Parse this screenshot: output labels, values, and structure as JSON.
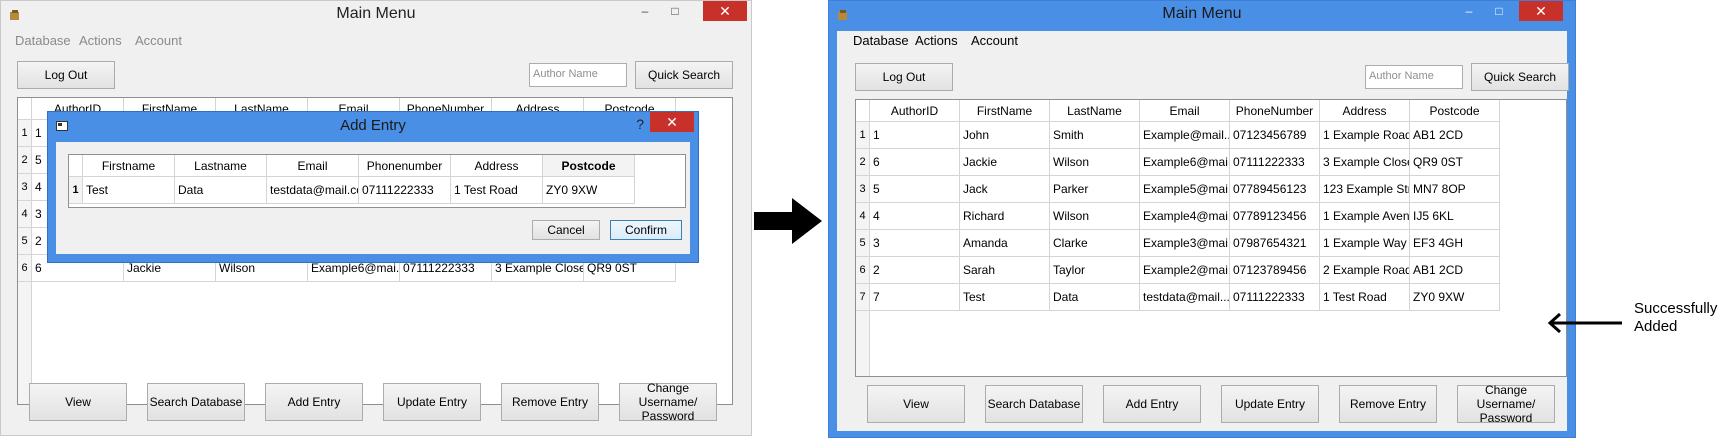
{
  "left_window": {
    "title": "Main Menu",
    "menu": [
      "Database",
      "Actions",
      "Account"
    ],
    "logout_label": "Log Out",
    "search_placeholder": "Author Name",
    "quick_search_label": "Quick Search",
    "columns": [
      "AuthorID",
      "FirstName",
      "LastName",
      "Email",
      "PhoneNumber",
      "Address",
      "Postcode"
    ],
    "rows": [
      {
        "num": "1",
        "cells": [
          "1",
          "",
          "",
          "",
          "",
          "",
          ""
        ]
      },
      {
        "num": "2",
        "cells": [
          "5",
          "",
          "",
          "",
          "",
          "",
          ""
        ]
      },
      {
        "num": "3",
        "cells": [
          "4",
          "",
          "",
          "",
          "",
          "",
          ""
        ]
      },
      {
        "num": "4",
        "cells": [
          "3",
          "",
          "",
          "",
          "",
          "",
          ""
        ]
      },
      {
        "num": "5",
        "cells": [
          "2",
          "",
          "",
          "",
          "",
          "",
          ""
        ]
      },
      {
        "num": "6",
        "cells": [
          "6",
          "Jackie",
          "Wilson",
          "Example6@mai...",
          "07111222333",
          "3 Example Close",
          "QR9 0ST"
        ]
      }
    ],
    "buttons": [
      "View",
      "Search Database",
      "Add Entry",
      "Update Entry",
      "Remove Entry",
      "Change Username/ Password"
    ]
  },
  "dialog": {
    "title": "Add Entry",
    "help_glyph": "?",
    "columns": [
      "Firstname",
      "Lastname",
      "Email",
      "Phonenumber",
      "Address",
      "Postcode"
    ],
    "row_num": "1",
    "row": [
      "Test",
      "Data",
      "testdata@mail.com",
      "07111222333",
      "1 Test Road",
      "ZY0 9XW"
    ],
    "cancel_label": "Cancel",
    "confirm_label": "Confirm"
  },
  "right_window": {
    "title": "Main Menu",
    "menu": [
      "Database",
      "Actions",
      "Account"
    ],
    "logout_label": "Log Out",
    "search_placeholder": "Author Name",
    "quick_search_label": "Quick Search",
    "columns": [
      "AuthorID",
      "FirstName",
      "LastName",
      "Email",
      "PhoneNumber",
      "Address",
      "Postcode"
    ],
    "rows": [
      {
        "num": "1",
        "cells": [
          "1",
          "John",
          "Smith",
          "Example@mail....",
          "07123456789",
          "1 Example Road",
          "AB1 2CD"
        ]
      },
      {
        "num": "2",
        "cells": [
          "6",
          "Jackie",
          "Wilson",
          "Example6@mai...",
          "07111222333",
          "3 Example Close",
          "QR9 0ST"
        ]
      },
      {
        "num": "3",
        "cells": [
          "5",
          "Jack",
          "Parker",
          "Example5@mai...",
          "07789456123",
          "123 Example Str...",
          "MN7 8OP"
        ]
      },
      {
        "num": "4",
        "cells": [
          "4",
          "Richard",
          "Wilson",
          "Example4@mai...",
          "07789123456",
          "1 Example Aven...",
          "IJ5 6KL"
        ]
      },
      {
        "num": "5",
        "cells": [
          "3",
          "Amanda",
          "Clarke",
          "Example3@mai...",
          "07987654321",
          "1 Example Way",
          "EF3 4GH"
        ]
      },
      {
        "num": "6",
        "cells": [
          "2",
          "Sarah",
          "Taylor",
          "Example2@mai...",
          "07123789456",
          "2 Example Road",
          "AB1 2CD"
        ]
      },
      {
        "num": "7",
        "cells": [
          "7",
          "Test",
          "Data",
          "testdata@mail....",
          "07111222333",
          "1 Test Road",
          "ZY0 9XW"
        ]
      }
    ],
    "buttons": [
      "View",
      "Search Database",
      "Add Entry",
      "Update Entry",
      "Remove Entry",
      "Change Username/ Password"
    ]
  },
  "annotation": {
    "line1": "Successfully",
    "line2": "Added"
  },
  "colors": {
    "titlebar_active": "#4a8fe6",
    "close_button": "#c7312a",
    "window_bg": "#f0f0f0"
  }
}
